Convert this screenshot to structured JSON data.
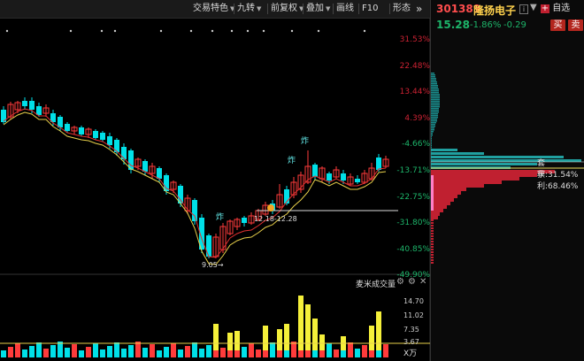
{
  "toolbar": {
    "items": [
      {
        "label": "交易特色",
        "has_caret": true
      },
      {
        "label": "九转",
        "has_caret": true
      },
      {
        "label": "前复权",
        "has_caret": true
      },
      {
        "label": "叠加",
        "has_caret": true
      },
      {
        "label": "画线",
        "has_caret": false
      },
      {
        "label": "F10",
        "has_caret": false
      },
      {
        "label": "形态",
        "has_caret": false
      }
    ],
    "expand_glyph": "»"
  },
  "stock": {
    "code": "301389",
    "name": "隆扬电子",
    "info_icon": "i",
    "price": "15.28",
    "change_pct": "-1.86%",
    "change_abs": "-0.29",
    "add_fav_label": "自选",
    "buy_label": "买",
    "sell_label": "卖"
  },
  "percent_axis": [
    "31.53%",
    "22.48%",
    "13.44%",
    "4.39%",
    "-4.66%",
    "-13.71%",
    "-22.75%",
    "-31.80%",
    "-40.85%",
    "-49.90%"
  ],
  "chip_labels": {
    "trapped": "套牢:31.54%",
    "profit": "获利:68.46%"
  },
  "chart_annotations": {
    "low_label": "9.05→",
    "range_label": "12.18-12.28",
    "bomb_marks": [
      "炸",
      "炸",
      "炸"
    ]
  },
  "volume_panel": {
    "title": "麦米成交量",
    "ticks": [
      "14.70",
      "11.02",
      "7.35",
      "3.67"
    ],
    "unit": "X万"
  },
  "colors": {
    "up": "#ff3b3b",
    "down": "#00e0e8",
    "ma_red": "#e03030",
    "ma_yellow": "#e8d04a",
    "chip_teal": "#1a8a8a",
    "chip_red": "#c02030",
    "volume_yellow": "#f5f03a"
  }
}
